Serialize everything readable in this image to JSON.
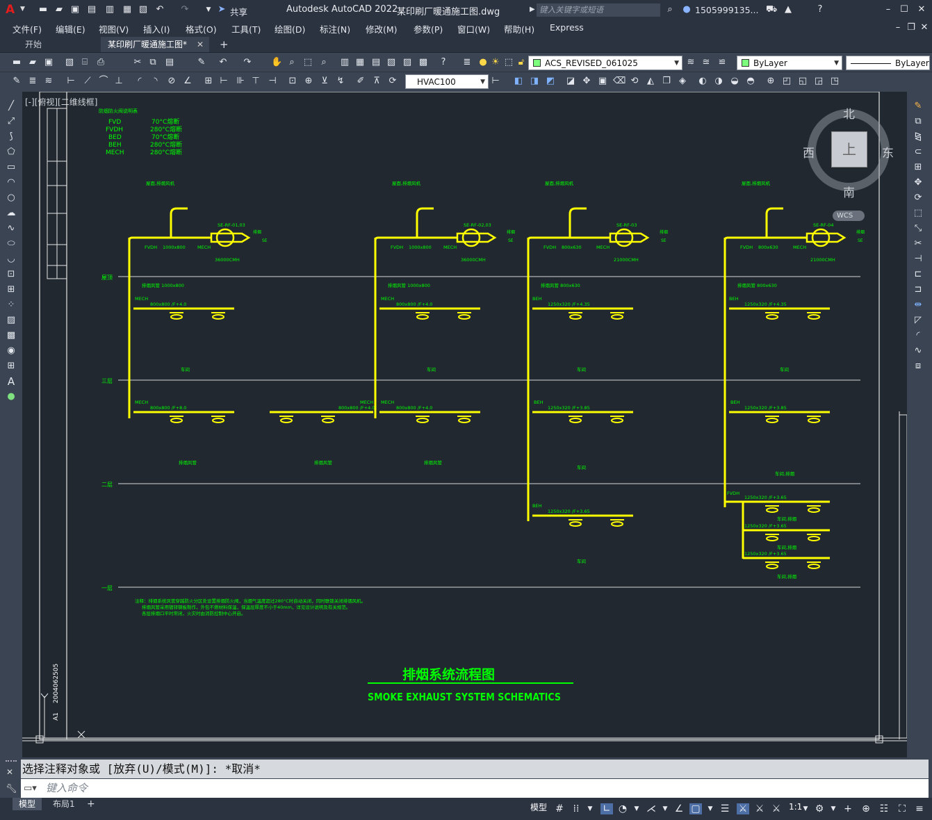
{
  "title": {
    "app_name": "Autodesk AutoCAD 2022",
    "file_name": "某印刷厂暖通施工图.dwg",
    "search_placeholder": "键入关键字或短语",
    "user": "1505999135...",
    "share": "共享"
  },
  "menu": [
    "文件(F)",
    "编辑(E)",
    "视图(V)",
    "插入(I)",
    "格式(O)",
    "工具(T)",
    "绘图(D)",
    "标注(N)",
    "修改(M)",
    "参数(P)",
    "窗口(W)",
    "帮助(H)",
    "Express"
  ],
  "tabs": {
    "start": "开始",
    "active": "某印刷厂暖通施工图*",
    "add": "+"
  },
  "toolbar": {
    "layer": "ACS_REVISED_061025",
    "color": "ByLayer",
    "linetype": "ByLayer",
    "dimstyle": "HVAC100"
  },
  "viewport": {
    "label": "[-][俯视][二维线框]",
    "viewcube": {
      "north": "北",
      "south": "南",
      "east": "东",
      "west": "西",
      "top": "上"
    },
    "wcs": "WCS"
  },
  "drawing": {
    "title_cn": "排烟系统流程图",
    "title_en": "SMOKE EXHAUST SYSTEM SCHEMATICS",
    "legend_codes": [
      "FVD",
      "FVDH",
      "BED",
      "BEH",
      "MECH"
    ],
    "legend_temps": [
      "70°C熔断",
      "280°C熔断",
      "70°C熔断",
      "280°C熔断",
      "280°C熔断"
    ],
    "levels": [
      "屋顶",
      "三层",
      "二层",
      "一层"
    ],
    "fans": [
      "SE-RF-01,03",
      "SE-RF-02,03",
      "SE-RF-03",
      "SE-RF-04"
    ],
    "fan_flows": [
      "36000CMH",
      "36000CMH",
      "21000CMH",
      "21000CMH"
    ],
    "roof_ducts": [
      "1000x800",
      "1000x800",
      "800x630",
      "800x630"
    ],
    "branches": [
      {
        "tag": "MECH",
        "label": "800x800 /F+4.0"
      },
      {
        "tag": "MECH",
        "label": "800x800 /F+4.0"
      },
      {
        "tag": "BEH",
        "label": "1250x320 /F+4.35"
      },
      {
        "tag": "BEH",
        "label": "1250x320 /F+4.35"
      },
      {
        "tag": "MECH",
        "label": "800x800 /F+8.0"
      },
      {
        "tag": "MECH",
        "label": "800x800 /F+4.0"
      },
      {
        "tag": "MECH",
        "label": "800x800 /F+8.0"
      },
      {
        "tag": "BEH",
        "label": "1250x320 /F+3.85"
      },
      {
        "tag": "BEH",
        "label": "1250x320 /F+3.85"
      },
      {
        "tag": "BEH",
        "label": "1250x320 /F+3.65"
      },
      {
        "tag": "FVDH",
        "label": "1250x320 /F+3.65"
      },
      {
        "tag": "",
        "label": "1250x320 /F+3.65"
      },
      {
        "tag": "",
        "label": "1250x320 /F+3.65"
      }
    ],
    "sheet_no": "2004062505",
    "sheet_size": "A1"
  },
  "command": {
    "history": "选择注释对象或 [放弃(U)/模式(M)]: *取消*",
    "placeholder": "键入命令"
  },
  "status": {
    "tab_model": "模型",
    "tab_layout": "布局1",
    "add": "+",
    "model_btn": "模型",
    "scale": "1:1"
  },
  "colors": {
    "canvas_bg": "#212830",
    "duct": "#ffff00",
    "text_green": "#00ff00",
    "ui_dark": "#2b3240",
    "ui_mid": "#3b4453",
    "accent": "#e11d1d"
  }
}
